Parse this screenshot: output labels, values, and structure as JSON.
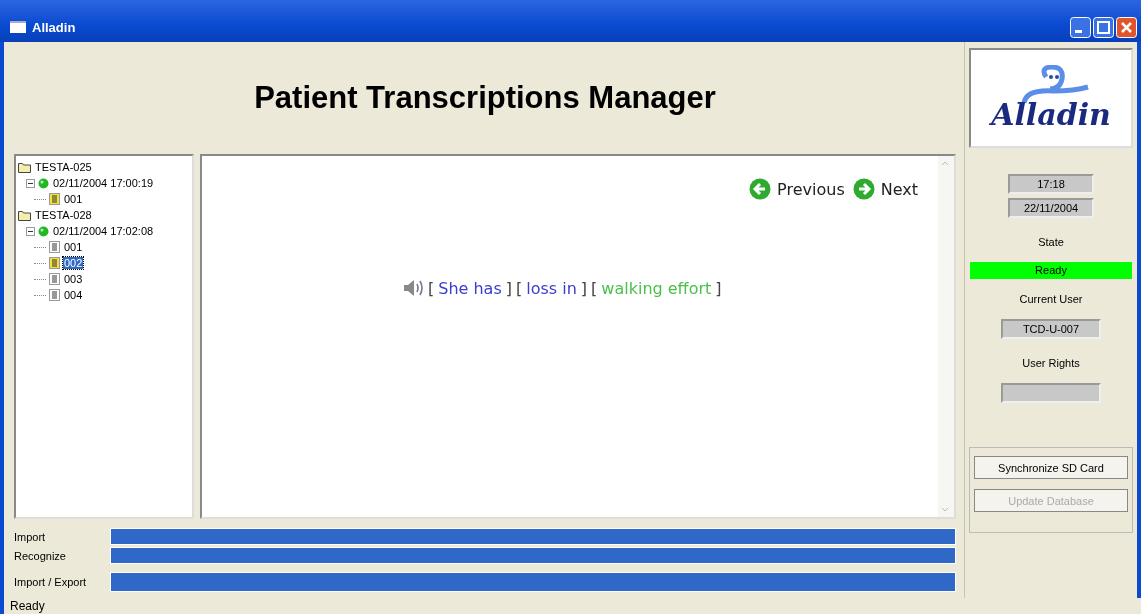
{
  "window": {
    "title": "Alladin"
  },
  "header": {
    "title": "Patient Transcriptions Manager"
  },
  "logo": {
    "text": "Alladin"
  },
  "tree": [
    {
      "kind": "folder",
      "label": "TESTA-025",
      "children": [
        {
          "kind": "session",
          "label": "02/11/2004 17:00:19",
          "expanded": true,
          "children": [
            {
              "kind": "doc",
              "label": "001",
              "highlighted": true,
              "selected": false
            }
          ]
        }
      ]
    },
    {
      "kind": "folder",
      "label": "TESTA-028",
      "children": [
        {
          "kind": "session",
          "label": "02/11/2004 17:02:08",
          "expanded": true,
          "children": [
            {
              "kind": "doc",
              "label": "001",
              "highlighted": false,
              "selected": false
            },
            {
              "kind": "doc",
              "label": "002",
              "highlighted": true,
              "selected": true
            },
            {
              "kind": "doc",
              "label": "003",
              "highlighted": false,
              "selected": false
            },
            {
              "kind": "doc",
              "label": "004",
              "highlighted": false,
              "selected": false
            }
          ]
        }
      ]
    }
  ],
  "navigation": {
    "previous": "Previous",
    "next": "Next"
  },
  "transcription": [
    {
      "text": "She has",
      "color": "#3c3cd0"
    },
    {
      "text": "loss in",
      "color": "#3c3cd0"
    },
    {
      "text": "walking effort",
      "color": "#4cc04c"
    }
  ],
  "bracket_open": "[",
  "bracket_close": "]",
  "progress": [
    {
      "label": "Import",
      "level": 1
    },
    {
      "label": "Recognize",
      "level": 1
    },
    {
      "label": "Import / Export",
      "level": 1
    }
  ],
  "side": {
    "time": "17:18",
    "date": "22/11/2004",
    "state_label": "State",
    "state": "Ready",
    "user_label": "Current User",
    "user": "TCD-U-007",
    "rights_label": "User Rights"
  },
  "buttons": [
    {
      "label": "Synchronize SD Card",
      "disabled": false
    },
    {
      "label": "Update Database",
      "disabled": true
    }
  ],
  "status_bar": "Ready"
}
